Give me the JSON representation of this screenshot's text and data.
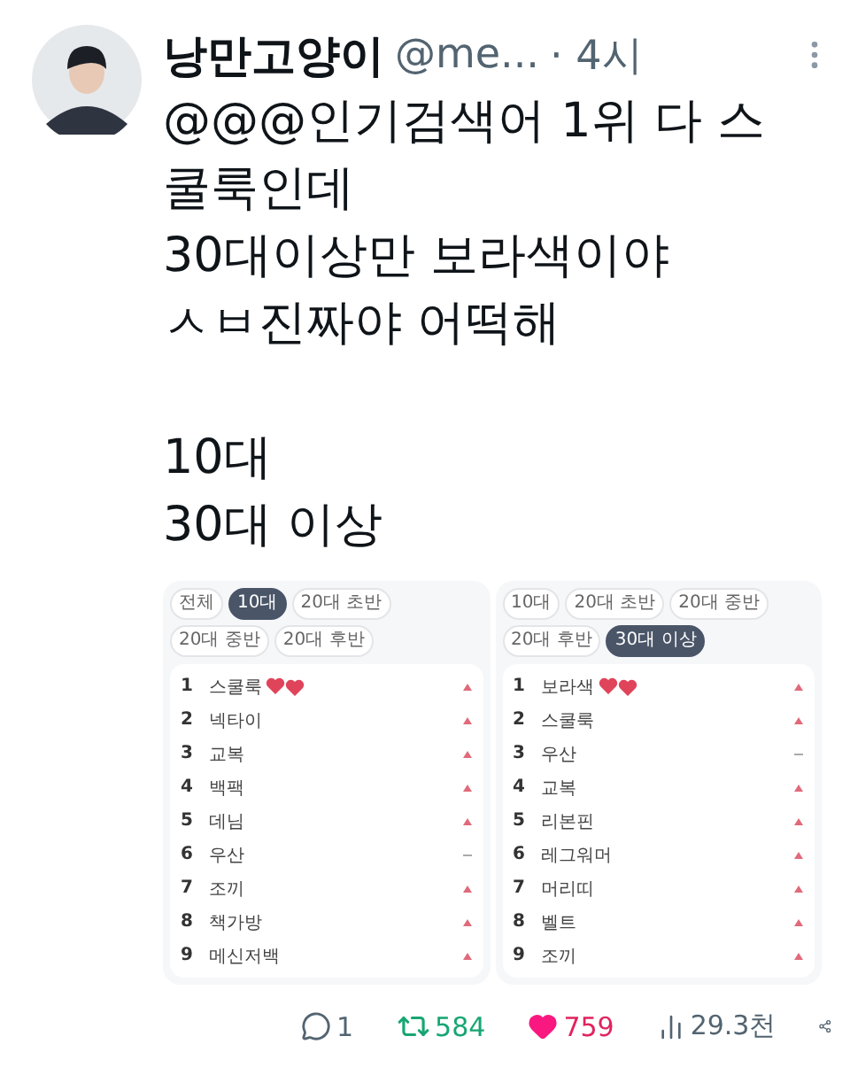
{
  "author": {
    "name": "낭만고양이",
    "handle": "@me...",
    "time": "· 4시"
  },
  "text": [
    "@@@인기검색어 1위 다 스쿨룩인데\n30대이상만 보라색이야\nㅅㅂ진짜야 어떡해",
    "10대\n30대 이상"
  ],
  "panels": [
    {
      "tabs": [
        {
          "label": "전체",
          "selected": false
        },
        {
          "label": "10대",
          "selected": true
        },
        {
          "label": "20대 초반",
          "selected": false
        },
        {
          "label": "20대 중반",
          "selected": false
        },
        {
          "label": "20대 후반",
          "selected": false
        }
      ],
      "items": [
        {
          "rank": "1",
          "label": "스쿨룩",
          "kind": "up",
          "hearts": true
        },
        {
          "rank": "2",
          "label": "넥타이",
          "kind": "up",
          "hearts": false
        },
        {
          "rank": "3",
          "label": "교복",
          "kind": "up",
          "hearts": false
        },
        {
          "rank": "4",
          "label": "백팩",
          "kind": "up",
          "hearts": false
        },
        {
          "rank": "5",
          "label": "데님",
          "kind": "up",
          "hearts": false
        },
        {
          "rank": "6",
          "label": "우산",
          "kind": "same",
          "hearts": false
        },
        {
          "rank": "7",
          "label": "조끼",
          "kind": "up",
          "hearts": false
        },
        {
          "rank": "8",
          "label": "책가방",
          "kind": "up",
          "hearts": false
        },
        {
          "rank": "9",
          "label": "메신저백",
          "kind": "up",
          "hearts": false
        }
      ]
    },
    {
      "tabs": [
        {
          "label": "10대",
          "selected": false
        },
        {
          "label": "20대 초반",
          "selected": false
        },
        {
          "label": "20대 중반",
          "selected": false
        },
        {
          "label": "20대 후반",
          "selected": false
        },
        {
          "label": "30대 이상",
          "selected": true
        }
      ],
      "items": [
        {
          "rank": "1",
          "label": "보라색",
          "kind": "up",
          "hearts": true
        },
        {
          "rank": "2",
          "label": "스쿨룩",
          "kind": "up",
          "hearts": false
        },
        {
          "rank": "3",
          "label": "우산",
          "kind": "same",
          "hearts": false
        },
        {
          "rank": "4",
          "label": "교복",
          "kind": "up",
          "hearts": false
        },
        {
          "rank": "5",
          "label": "리본핀",
          "kind": "up",
          "hearts": false
        },
        {
          "rank": "6",
          "label": "레그워머",
          "kind": "up",
          "hearts": false
        },
        {
          "rank": "7",
          "label": "머리띠",
          "kind": "up",
          "hearts": false
        },
        {
          "rank": "8",
          "label": "벨트",
          "kind": "up",
          "hearts": false
        },
        {
          "rank": "9",
          "label": "조끼",
          "kind": "up",
          "hearts": false
        }
      ]
    }
  ],
  "stats": {
    "replies": "1",
    "retweets": "584",
    "likes": "759",
    "views": "29.3천"
  }
}
